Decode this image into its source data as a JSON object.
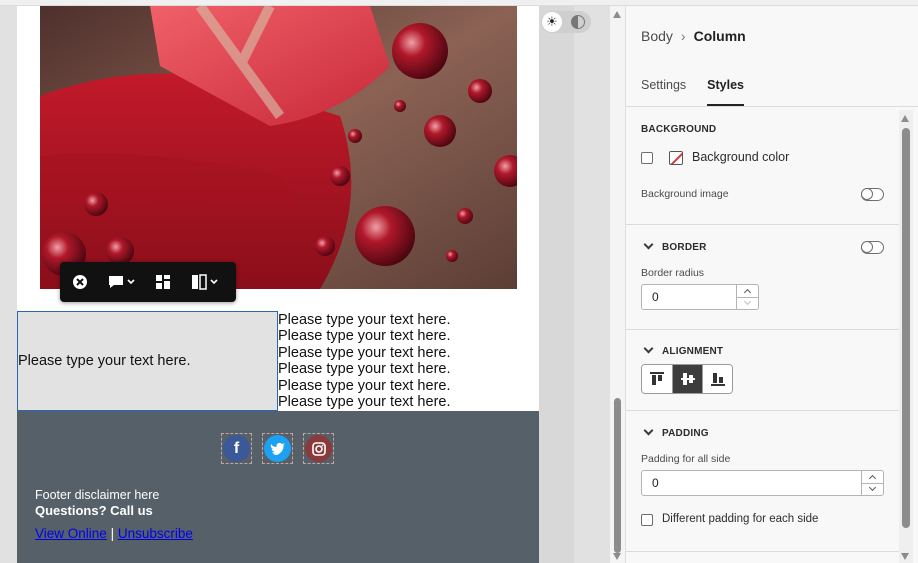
{
  "canvas": {
    "hero_image_alt": "Red wrapped gift with ribbon and Christmas ornaments",
    "toolbar": {
      "close": "close",
      "comment": "comment",
      "layout": "layout",
      "columns": "columns"
    },
    "row": {
      "left_text": "Please type your text here.",
      "right_lines": [
        "Please type your text here.",
        "Please type your text here.",
        "Please type your text here.",
        "Please type your text here.",
        "Please type your text here.",
        "Please type your text here."
      ]
    },
    "footer": {
      "social": [
        "facebook-icon",
        "twitter-icon",
        "instagram-icon"
      ],
      "disclaimer": "Footer disclaimer here",
      "callus": "Questions? Call us",
      "view_online": "View Online",
      "separator": "|",
      "unsubscribe": "Unsubscribe"
    },
    "colors": {
      "footer_bg": "#556068",
      "selection_border": "#2b67b3",
      "link": "#0000ee"
    }
  },
  "panel": {
    "breadcrumb": {
      "parent": "Body",
      "separator": "›",
      "current": "Column"
    },
    "tabs": [
      {
        "label": "Settings",
        "active": false
      },
      {
        "label": "Styles",
        "active": true
      }
    ],
    "background": {
      "title": "BACKGROUND",
      "color_label": "Background color",
      "image_label": "Background image",
      "image_enabled": false
    },
    "border": {
      "title": "BORDER",
      "enabled": false,
      "radius_label": "Border radius",
      "radius_value": "0"
    },
    "alignment": {
      "title": "ALIGNMENT",
      "options": [
        "align-top-icon",
        "align-middle-icon",
        "align-bottom-icon"
      ],
      "selected": "align-middle-icon"
    },
    "padding": {
      "title": "PADDING",
      "all_label": "Padding for all side",
      "all_value": "0",
      "each_label": "Different padding for each side"
    }
  }
}
